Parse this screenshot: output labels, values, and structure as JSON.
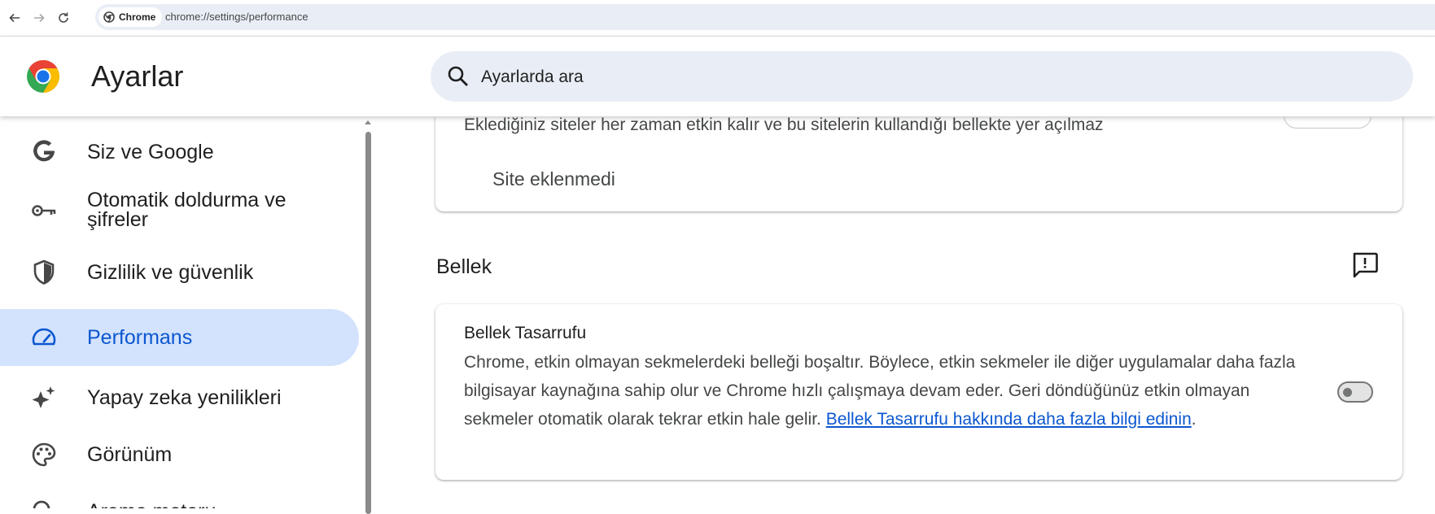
{
  "browser": {
    "chip_label": "Chrome",
    "url": "chrome://settings/performance"
  },
  "header": {
    "title": "Ayarlar",
    "search_placeholder": "Ayarlarda ara"
  },
  "sidebar": {
    "items": [
      {
        "label": "Siz ve Google",
        "icon": "google-g-icon",
        "active": false
      },
      {
        "label": "Otomatik doldurma ve şifreler",
        "icon": "key-icon",
        "active": false
      },
      {
        "label": "Gizlilik ve güvenlik",
        "icon": "shield-icon",
        "active": false
      },
      {
        "label": "Performans",
        "icon": "speedometer-icon",
        "active": true
      },
      {
        "label": "Yapay zeka yenilikleri",
        "icon": "sparkle-icon",
        "active": false
      },
      {
        "label": "Görünüm",
        "icon": "palette-icon",
        "active": false
      },
      {
        "label": "Arama motoru",
        "icon": "search-icon",
        "active": false
      }
    ]
  },
  "main": {
    "partial_text": "Eklediğiniz siteler her zaman etkin kalır ve bu sitelerin kullandığı bellekte yer açılmaz",
    "no_site_text": "Site eklenmedi",
    "section_title": "Bellek",
    "memory_saver": {
      "title": "Bellek Tasarrufu",
      "description": "Chrome, etkin olmayan sekmelerdeki belleği boşaltır. Böylece, etkin sekmeler ile diğer uygulamalar daha fazla bilgisayar kaynağına sahip olur ve Chrome hızlı çalışmaya devam eder. Geri döndüğünüz etkin olmayan sekmeler otomatik olarak tekrar etkin hale gelir. ",
      "link_text": "Bellek Tasarrufu hakkında daha fazla bilgi edinin",
      "trailing": ".",
      "enabled": false
    }
  },
  "colors": {
    "accent": "#0b57d0",
    "active_bg": "#d3e3fd",
    "search_bg": "#e9eef6"
  }
}
